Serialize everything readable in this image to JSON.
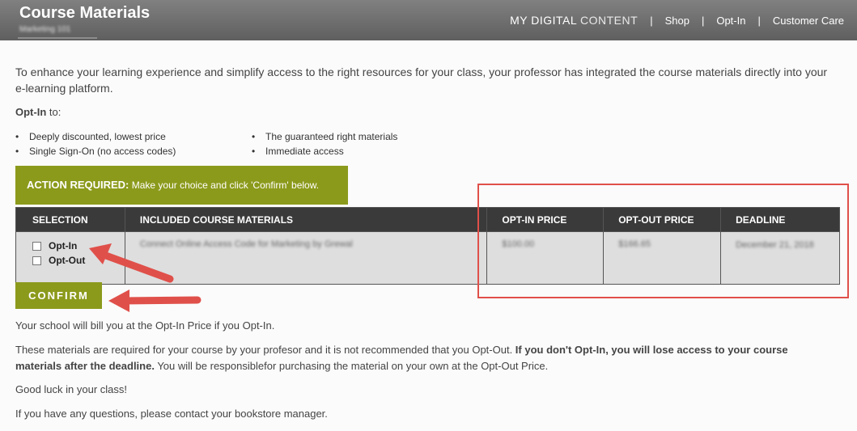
{
  "header": {
    "title": "Course Materials",
    "subtitle": "Marketing 101",
    "nav": {
      "brand_a": "MY DIGITAL",
      "brand_b": "CONTENT",
      "shop": "Shop",
      "optin": "Opt-In",
      "care": "Customer Care",
      "separator": "|"
    }
  },
  "intro": "To enhance your learning experience and simplify access to the right resources for your class, your professor has integrated the course materials directly into your e-learning platform.",
  "optin_to": {
    "bold": "Opt-In",
    "rest": " to:"
  },
  "benefits_left": [
    "Deeply discounted, lowest price",
    "Single Sign-On (no access codes)"
  ],
  "benefits_right": [
    "The guaranteed right materials",
    "Immediate access"
  ],
  "action": {
    "bold": "ACTION REQUIRED:",
    "text": " Make your choice and click 'Confirm' below."
  },
  "table": {
    "headers": [
      "SELECTION",
      "INCLUDED COURSE MATERIALS",
      "OPT-IN PRICE",
      "OPT-OUT PRICE",
      "DEADLINE"
    ],
    "row": {
      "option_in": "Opt-In",
      "option_out": "Opt-Out",
      "material": "Connect Online Access Code for Marketing by Grewal",
      "optin_price": "$100.00",
      "optout_price": "$166.65",
      "deadline": "December 21, 2018"
    }
  },
  "confirm_label": "CONFIRM",
  "footer": {
    "line1": "Your school will bill you at the Opt-In Price if you Opt-In.",
    "line2_a": "These materials are required for your course by your profesor and it is not recommended that you Opt-Out. ",
    "line2_b": "If you don't Opt-In, you will lose access to your course materials after the deadline.",
    "line2_c": " You will be responsiblefor purchasing the material on your own at the Opt-Out Price.",
    "line3": "Good luck in your class!",
    "line4": "If you have any questions, please contact your bookstore manager."
  },
  "colors": {
    "accent": "#8c9a1c",
    "header_bg": "#6e6e6e",
    "table_header": "#3a3a3a",
    "annotation": "#e0504a"
  }
}
